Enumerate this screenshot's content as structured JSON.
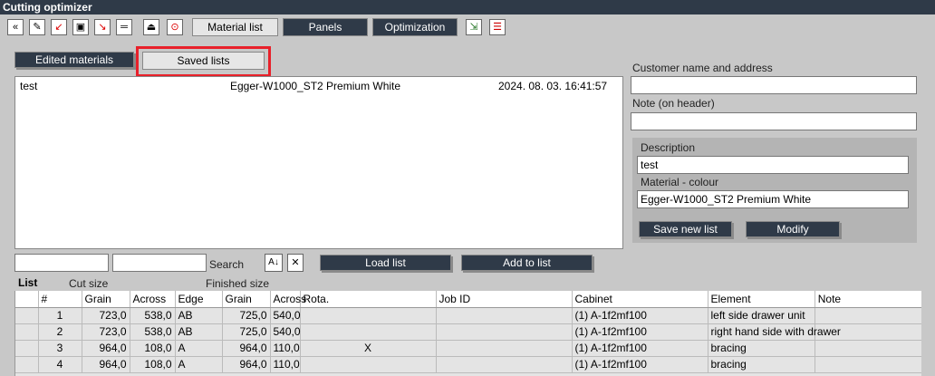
{
  "window": {
    "title": "Cutting optimizer"
  },
  "toolbar": {
    "icons": [
      "collapse-icon",
      "new-icon",
      "import-icon",
      "save-icon",
      "export-icon",
      "separator-icon",
      "print-preview-icon",
      "stop-icon"
    ],
    "tabs": [
      "Material list",
      "Panels",
      "Optimization"
    ],
    "extra_icons": [
      "report-icon",
      "list-icon"
    ]
  },
  "subtabs": {
    "edited": "Edited materials",
    "saved": "Saved lists"
  },
  "saved_lists": [
    {
      "name": "test",
      "material": "Egger-W1000_ST2 Premium White",
      "date": "2024. 08. 03. 16:41:57"
    }
  ],
  "right": {
    "customer_label": "Customer name and address",
    "customer_value": "",
    "note_label": "Note (on header)",
    "note_value": "",
    "description_label": "Description",
    "description_value": "test",
    "material_label": "Material - colour",
    "material_value": "Egger-W1000_ST2 Premium White",
    "save_new": "Save new list",
    "modify": "Modify"
  },
  "search": {
    "label": "Search",
    "field1": "",
    "field2": "",
    "load": "Load list",
    "add": "Add to list"
  },
  "list": {
    "title": "List",
    "cut_size": "Cut size",
    "finished_size": "Finished size",
    "columns": [
      "#",
      "Grain",
      "Across",
      "Edge",
      "Grain",
      "Across",
      "Rota.",
      "Job ID",
      "Cabinet",
      "Element",
      "Note"
    ],
    "rows": [
      [
        "1",
        "723,0",
        "538,0",
        "AB",
        "725,0",
        "540,0",
        "",
        "",
        "(1) A-1f2mf100",
        "left side drawer unit",
        ""
      ],
      [
        "2",
        "723,0",
        "538,0",
        "AB",
        "725,0",
        "540,0",
        "",
        "",
        "(1) A-1f2mf100",
        "right hand side with drawer",
        ""
      ],
      [
        "3",
        "964,0",
        "108,0",
        "A",
        "964,0",
        "110,0",
        "X",
        "",
        "(1) A-1f2mf100",
        "bracing",
        ""
      ],
      [
        "4",
        "964,0",
        "108,0",
        "A",
        "964,0",
        "110,0",
        "",
        "",
        "(1) A-1f2mf100",
        "bracing",
        ""
      ]
    ]
  }
}
